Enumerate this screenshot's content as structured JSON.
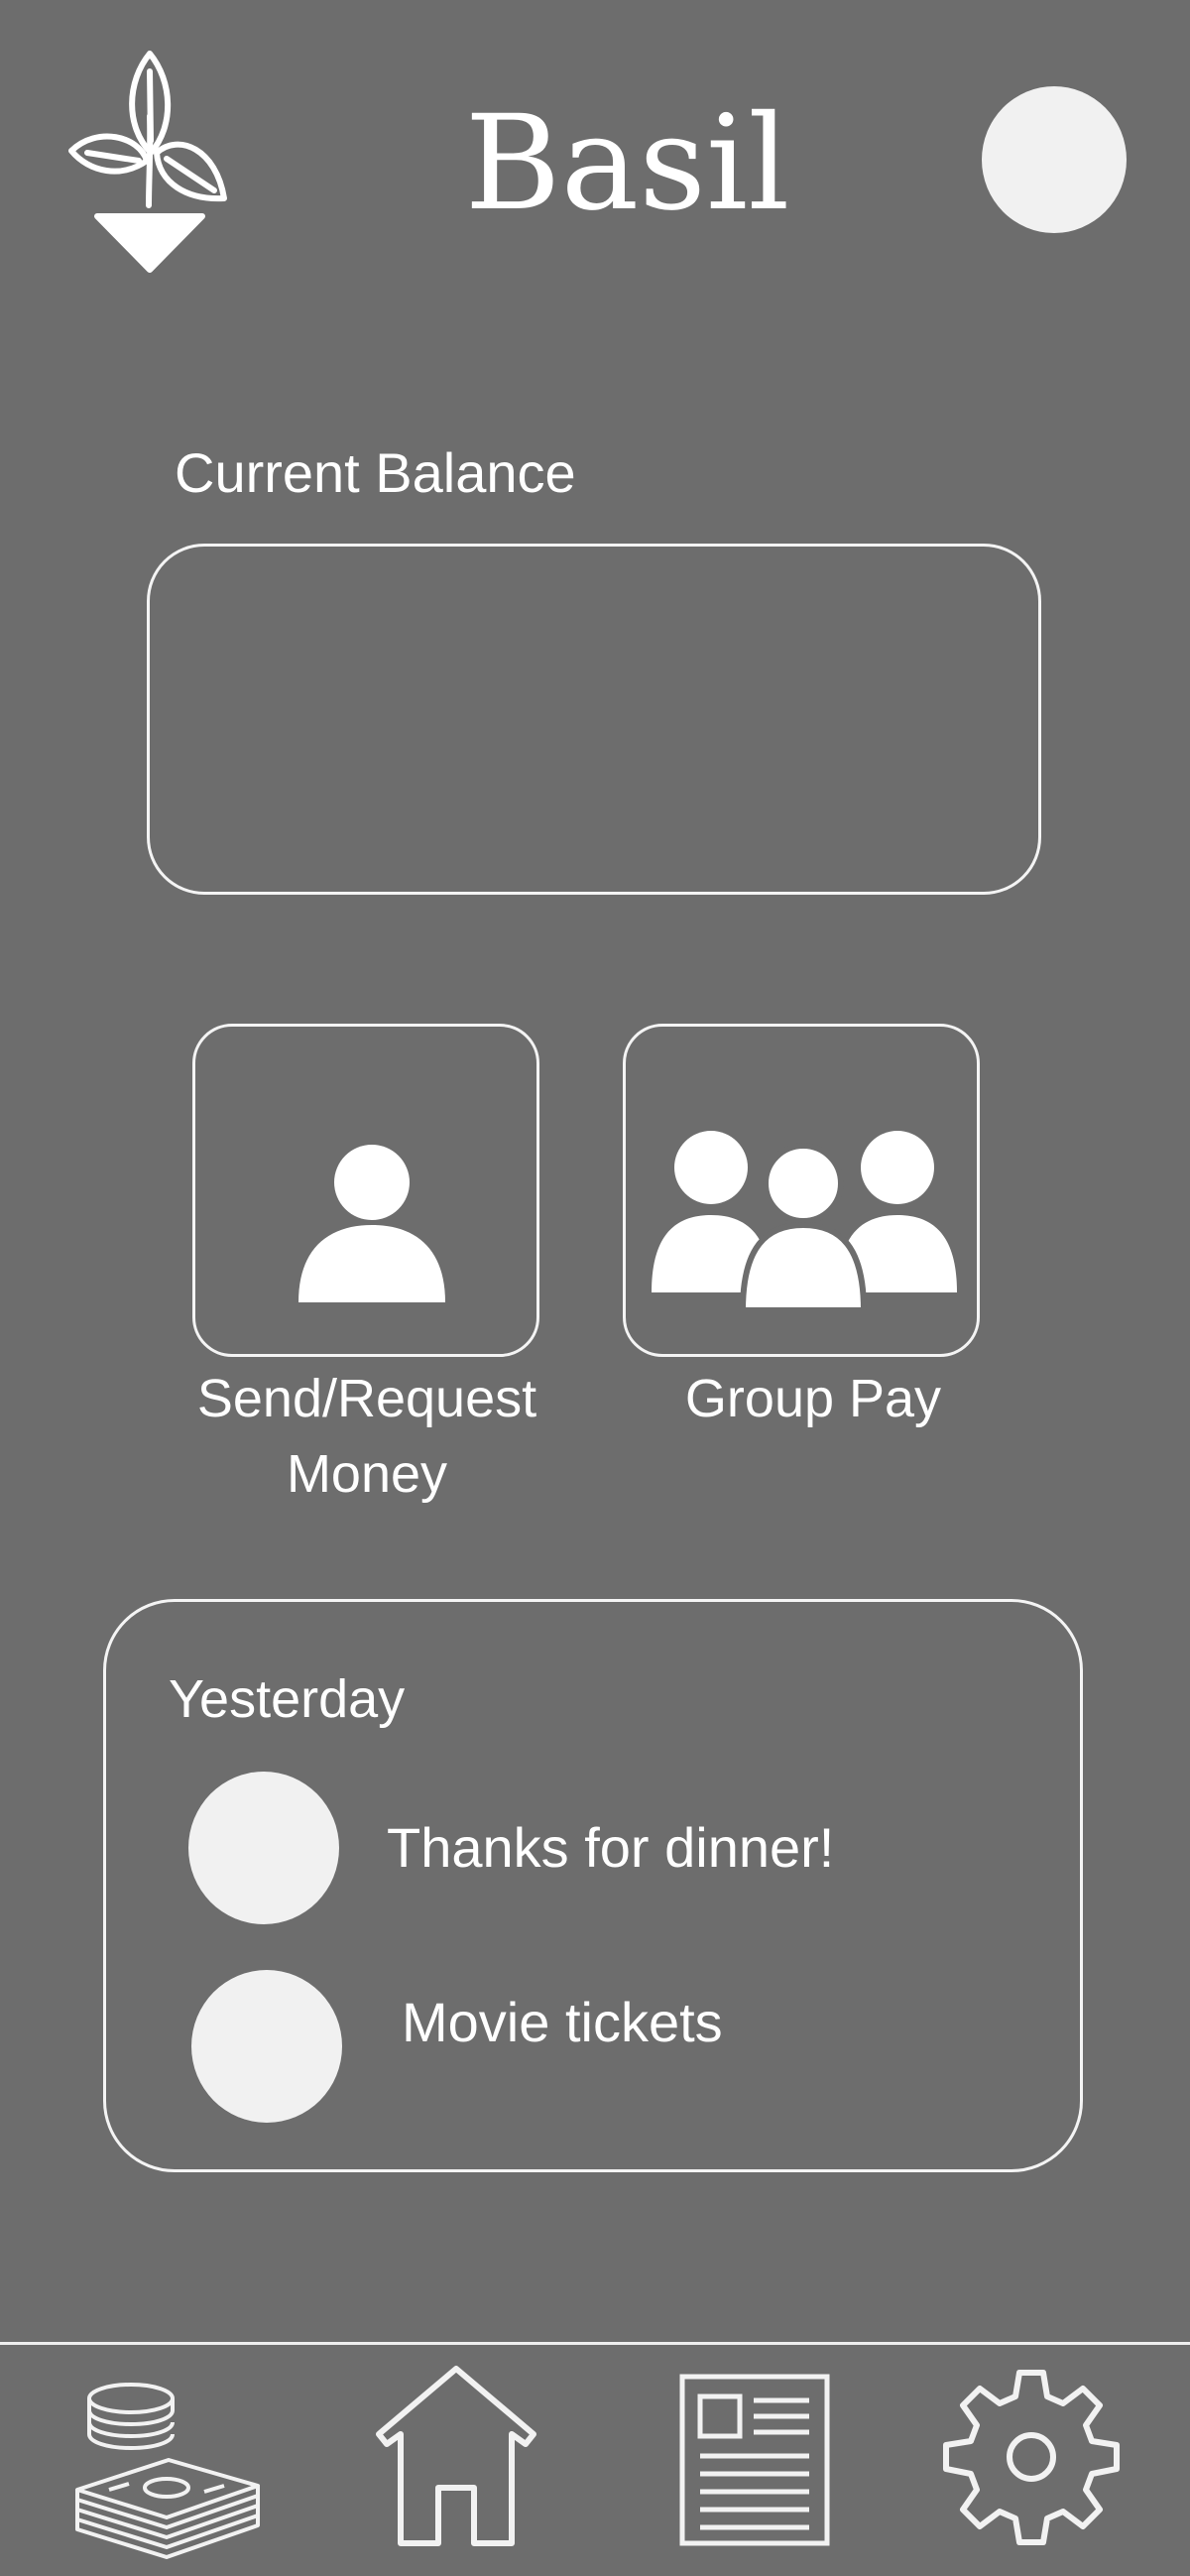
{
  "header": {
    "app_title": "Basil",
    "logo_icon": "basil-plant-icon",
    "avatar_icon": "user-avatar"
  },
  "balance": {
    "label": "Current Balance",
    "value": ""
  },
  "actions": [
    {
      "label_line1": "Send/Request",
      "label_line2": "Money",
      "icon": "single-user-icon"
    },
    {
      "label": "Group Pay",
      "icon": "group-users-icon"
    }
  ],
  "activity": {
    "heading": "Yesterday",
    "items": [
      {
        "label": "Thanks for dinner!"
      },
      {
        "label": "Movie tickets"
      }
    ]
  },
  "bottom_nav": [
    {
      "id": "money",
      "icon": "cash-coins-icon"
    },
    {
      "id": "home",
      "icon": "home-icon"
    },
    {
      "id": "news",
      "icon": "newspaper-icon"
    },
    {
      "id": "settings",
      "icon": "gear-icon"
    }
  ],
  "colors": {
    "background": "#6d6d6d",
    "foreground": "#ffffff",
    "avatar_fill": "#f1f1f1",
    "outline": "#f4f4f4"
  }
}
